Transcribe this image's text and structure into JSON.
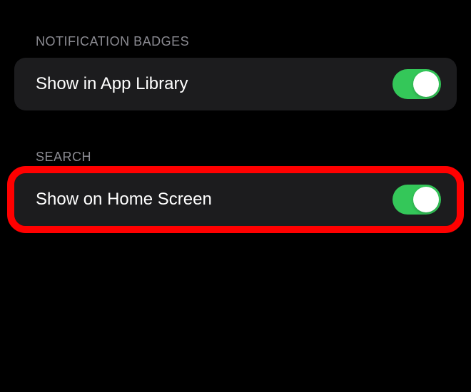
{
  "sections": {
    "notification_badges": {
      "header": "Notification Badges",
      "rows": {
        "show_in_app_library": {
          "label": "Show in App Library",
          "toggle_on": true
        }
      }
    },
    "search": {
      "header": "Search",
      "rows": {
        "show_on_home_screen": {
          "label": "Show on Home Screen",
          "toggle_on": true,
          "highlighted": true
        }
      }
    }
  },
  "colors": {
    "toggle_on": "#34c759",
    "highlight": "#ff0000"
  }
}
